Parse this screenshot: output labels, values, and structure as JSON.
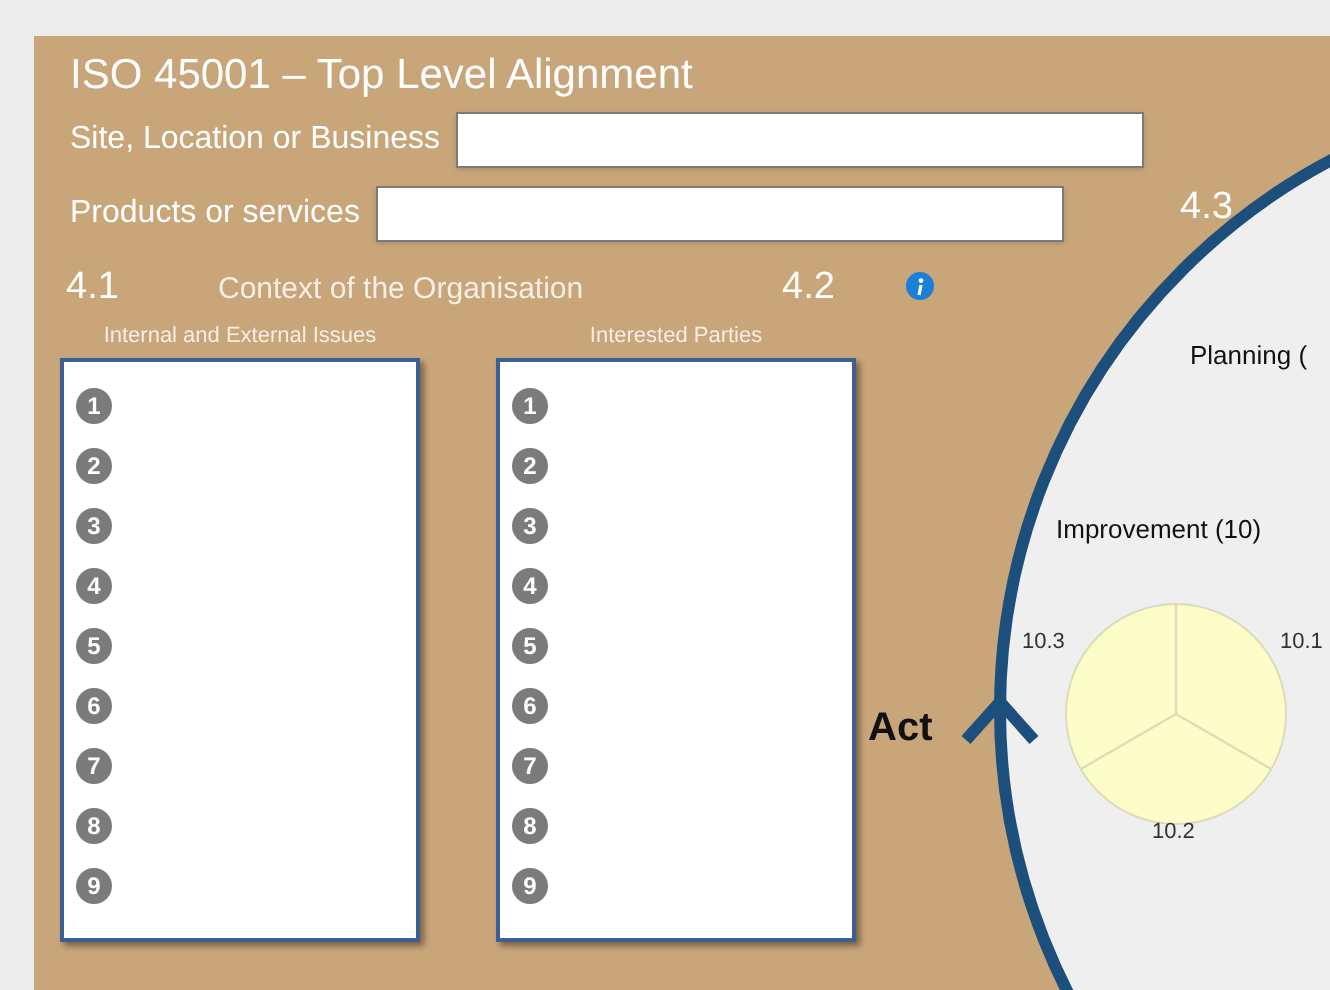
{
  "title": "ISO 45001 – Top Level Alignment",
  "fields": [
    {
      "label": "Site, Location or Business"
    },
    {
      "label": "Products or services"
    }
  ],
  "context": {
    "number": "4.1",
    "title": "Context of the Organisation",
    "parties_number": "4.2"
  },
  "lists": [
    {
      "heading": "Internal and External Issues",
      "items": [
        "1",
        "2",
        "3",
        "4",
        "5",
        "6",
        "7",
        "8",
        "9"
      ]
    },
    {
      "heading": "Interested Parties",
      "items": [
        "1",
        "2",
        "3",
        "4",
        "5",
        "6",
        "7",
        "8",
        "9"
      ]
    }
  ],
  "diagram": {
    "section": "4.3",
    "planning": "Planning (",
    "improvement": "Improvement  (10)",
    "act": "Act",
    "slices": [
      "10.1",
      "10.2",
      "10.3"
    ]
  }
}
